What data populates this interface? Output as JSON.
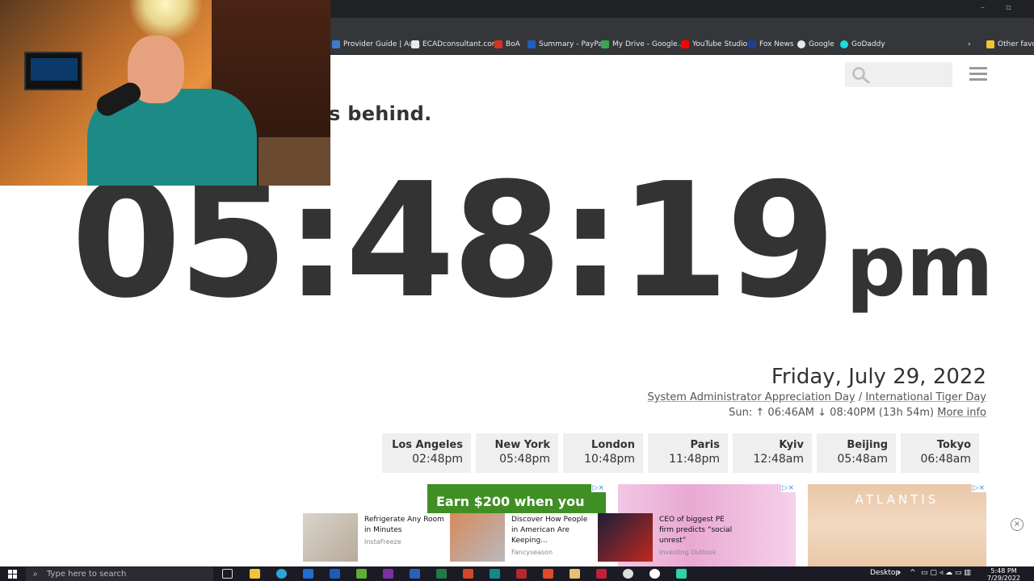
{
  "browser": {
    "bookmarks": [
      {
        "label": "Provider Guide | Au...",
        "color": "#3a7bd5"
      },
      {
        "label": "ECADconsultant.com",
        "color": "#e8eaed"
      },
      {
        "label": "BoA",
        "color": "#d93025"
      },
      {
        "label": "Summary - PayPal",
        "color": "#1f5fbf"
      },
      {
        "label": "My Drive - Google...",
        "color": "#34a853"
      },
      {
        "label": "YouTube Studio",
        "color": "#ff0000"
      },
      {
        "label": "Fox News",
        "color": "#1f3f8f"
      },
      {
        "label": "Google",
        "color": "#e8eaed"
      },
      {
        "label": "GoDaddy",
        "color": "#1bdbdb"
      }
    ],
    "other_favorites": "Other favori"
  },
  "page": {
    "headline": "s behind.",
    "time": "05:48:19",
    "ampm": "pm",
    "date": "Friday, July 29, 2022",
    "holiday_1": "System Administrator Appreciation Day",
    "holiday_sep": " / ",
    "holiday_2": "International Tiger Day",
    "sun_prefix": "Sun: ",
    "sunrise": "↑ 06:46AM",
    "sunset": "↓ 08:40PM",
    "daylength": "(13h 54m)",
    "more_info": "More info",
    "cities": [
      {
        "name": "Los Angeles",
        "time": "02:48pm"
      },
      {
        "name": "New York",
        "time": "05:48pm"
      },
      {
        "name": "London",
        "time": "10:48pm"
      },
      {
        "name": "Paris",
        "time": "11:48pm"
      },
      {
        "name": "Kyiv",
        "time": "12:48am"
      },
      {
        "name": "Beijing",
        "time": "05:48am"
      },
      {
        "name": "Tokyo",
        "time": "06:48am"
      }
    ]
  },
  "ads": {
    "earn_text": "Earn $200 when you",
    "atlantis_brand": "ATLANTIS",
    "native": [
      {
        "title": "Refrigerate Any Room in Minutes",
        "source": "InstaFreeze"
      },
      {
        "title": "Discover How People in American Are Keeping...",
        "source": "Fancyseason"
      },
      {
        "title": "CEO of biggest PE firm predicts “social unrest”",
        "source": "Investing Outlook"
      }
    ]
  },
  "taskbar": {
    "search_placeholder": "Type here to search",
    "desktop_label": "Desktop",
    "time": "5:48 PM",
    "date": "7/29/2022"
  }
}
